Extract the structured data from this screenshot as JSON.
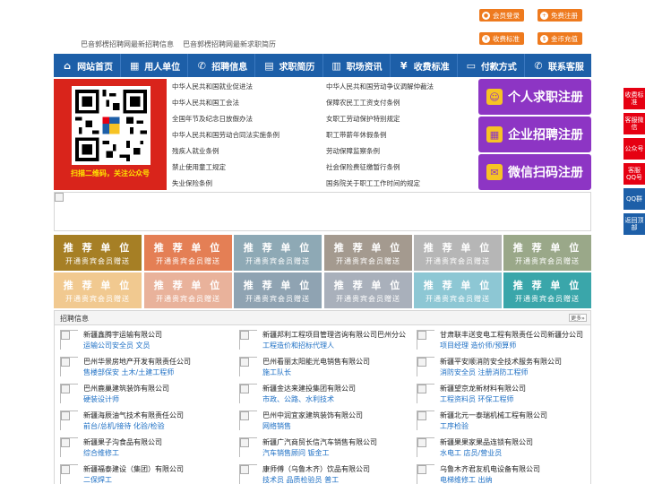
{
  "header": {
    "links": [
      "巴音郭楞招聘网最新招聘信息",
      "巴音郭楞招聘网最新求职简历"
    ],
    "buttons": [
      {
        "label": "会员登录",
        "icon": "user-icon"
      },
      {
        "label": "免费注册",
        "icon": "user-plus-icon"
      },
      {
        "label": "收费标准",
        "icon": "yen-icon"
      },
      {
        "label": "金币充值",
        "icon": "coin-icon"
      }
    ]
  },
  "nav": [
    {
      "label": "网站首页",
      "icon": "home-icon"
    },
    {
      "label": "用人单位",
      "icon": "building-icon"
    },
    {
      "label": "招聘信息",
      "icon": "chat-icon"
    },
    {
      "label": "求职简历",
      "icon": "resume-icon"
    },
    {
      "label": "职场资讯",
      "icon": "news-icon"
    },
    {
      "label": "收费标准",
      "icon": "yen-icon"
    },
    {
      "label": "付款方式",
      "icon": "card-icon"
    },
    {
      "label": "联系客服",
      "icon": "phone-icon"
    }
  ],
  "qr": {
    "caption": "扫描二维码，关注公众号"
  },
  "laws": {
    "left": [
      "中华人民共和国就业促进法",
      "中华人民共和国工会法",
      "全国年节及纪念日放假办法",
      "中华人民共和国劳动合同法实施条例",
      "残疾人就业条例",
      "禁止使用童工规定",
      "失业保险条例"
    ],
    "right": [
      "中华人民共和国劳动争议调解仲裁法",
      "保障农民工工资支付条例",
      "女职工劳动保护特别规定",
      "职工带薪年休假条例",
      "劳动保障监察条例",
      "社会保险费征缴暂行条例",
      "国务院关于职工工作时间的规定"
    ]
  },
  "register": [
    {
      "label": "个人求职注册",
      "icon": "person-icon"
    },
    {
      "label": "企业招聘注册",
      "icon": "company-icon"
    },
    {
      "label": "微信扫码注册",
      "icon": "wechat-icon"
    }
  ],
  "tiles": {
    "title": "推 荐 单 位",
    "subtitle": "开通贵宾会员赠送",
    "colors_row1": [
      "#a67f25",
      "#e47f55",
      "#8ea9b5",
      "#a49a8f",
      "#b6b6b6",
      "#9aa889"
    ],
    "colors_row2": [
      "#f1c990",
      "#e9b29b",
      "#8fa3b2",
      "#a9b0bb",
      "#8dc7d4",
      "#3aa6aa"
    ]
  },
  "jobs": {
    "title": "招聘信息",
    "more": "更多»",
    "items": [
      {
        "company": "新疆鑫腾宇运输有限公司",
        "positions": "运输公司安全员  文员"
      },
      {
        "company": "新疆邦利工程项目管理咨询有限公司巴州分公",
        "positions": "工程造价和招标代理人"
      },
      {
        "company": "甘肃联丰送变电工程有限责任公司新疆分公司",
        "positions": "项目经理  造价师/预算师"
      },
      {
        "company": "巴州华景房地产开发有限责任公司",
        "positions": "售楼部保安  土木/土建工程师"
      },
      {
        "company": "巴州看丽太阳能光电销售有限公司",
        "positions": "施工队长"
      },
      {
        "company": "新疆平安顺消防安全技术服务有限公司",
        "positions": "消防安全员  注册消防工程师"
      },
      {
        "company": "巴州鹿巢建筑装饰有限公司",
        "positions": "硬装设计师"
      },
      {
        "company": "新疆金达来建投集团有限公司",
        "positions": "市政、公路、水利技术"
      },
      {
        "company": "新疆望京龙新材料有限公司",
        "positions": "工程资料员  环保工程师"
      },
      {
        "company": "新疆海辰油气技术有限责任公司",
        "positions": "前台/总机/接待  化验/检验"
      },
      {
        "company": "巴州中润宜家建筑装饰有限公司",
        "positions": "网络销售"
      },
      {
        "company": "新疆北元一泰瑞机械工程有限公司",
        "positions": "工序检验"
      },
      {
        "company": "新疆果子沟食品有限公司",
        "positions": "综合维修工"
      },
      {
        "company": "新疆广汽商贸长信汽车销售有限公司",
        "positions": "汽车销售顾问  钣金工"
      },
      {
        "company": "新疆果果家果品连锁有限公司",
        "positions": "水电工  店员/营业员"
      },
      {
        "company": "新疆福泰建设（集团）有限公司",
        "positions": "二保焊工"
      },
      {
        "company": "康师傅（乌鲁木齐）饮品有限公司",
        "positions": "技术员  品质检验员  普工"
      },
      {
        "company": "乌鲁木齐君友机电设备有限公司",
        "positions": "电梯维修工  出纳"
      }
    ]
  },
  "side": [
    {
      "label": "收费标准",
      "color": "#e60012"
    },
    {
      "label": "客服微信",
      "color": "#e60012"
    },
    {
      "label": "公众号",
      "color": "#e60012"
    },
    {
      "label": "客服QQ号",
      "color": "#e60012"
    },
    {
      "label": "QQ群",
      "color": "#1d5fa8"
    },
    {
      "label": "返回顶部",
      "color": "#1d5fa8"
    }
  ]
}
